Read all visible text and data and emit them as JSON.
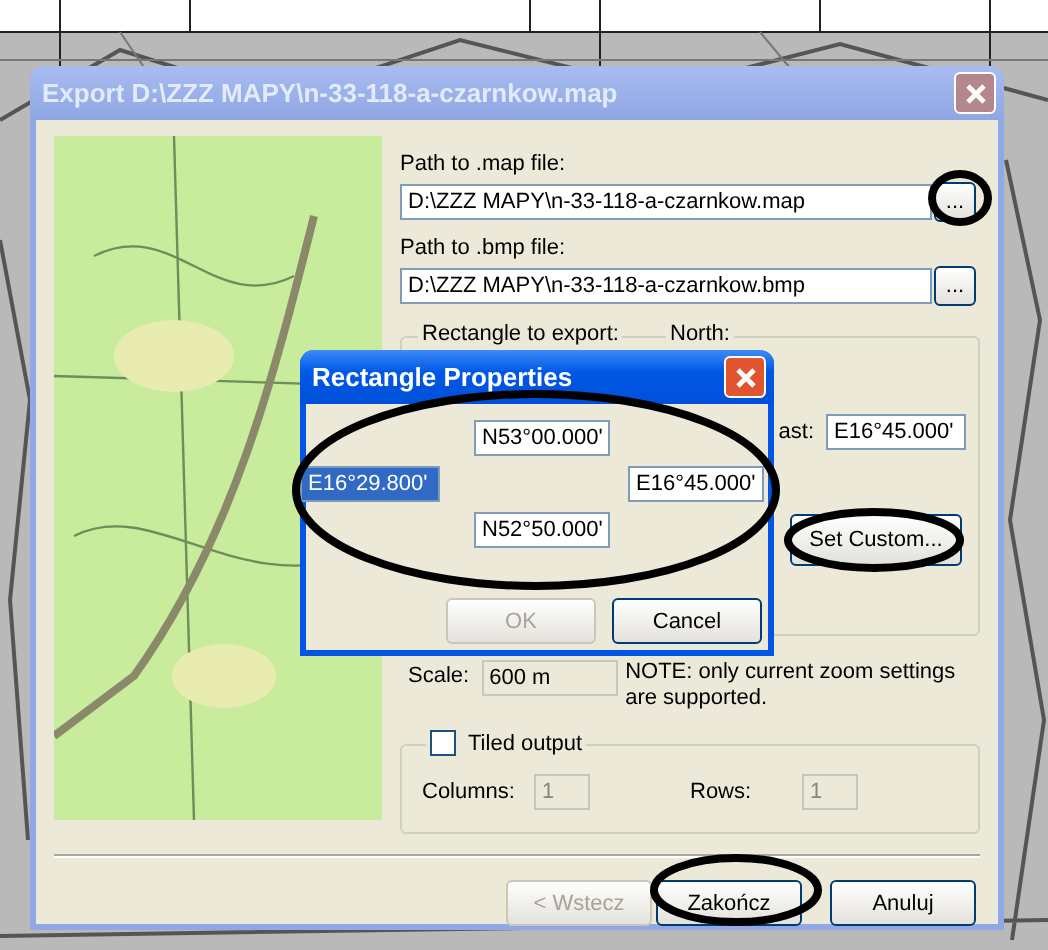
{
  "export_dialog": {
    "title": "Export D:\\ZZZ MAPY\\n-33-118-a-czarnkow.map",
    "map_file": {
      "label": "Path to .map file:",
      "value": "D:\\ZZZ MAPY\\n-33-118-a-czarnkow.map",
      "browse_button": "..."
    },
    "bmp_file": {
      "label": "Path to .bmp file:",
      "value": "D:\\ZZZ MAPY\\n-33-118-a-czarnkow.bmp",
      "browse_button": "..."
    },
    "rectangle_group": {
      "title": "Rectangle to export:",
      "north_label": "North:",
      "east_label": "ast:",
      "east_value": "E16°45.000'",
      "set_custom_button": "Set Custom..."
    },
    "scale": {
      "label": "Scale:",
      "value": "600 m"
    },
    "note": "NOTE: only current zoom settings are supported.",
    "tiled": {
      "label": "Tiled output",
      "checked": false,
      "disabled": true,
      "columns_label": "Columns:",
      "columns_value": "1",
      "rows_label": "Rows:",
      "rows_value": "1"
    },
    "buttons": [
      {
        "label": "< Wstecz",
        "disabled": true
      },
      {
        "label": "Zakończ",
        "disabled": false
      },
      {
        "label": "Anuluj",
        "disabled": false
      }
    ]
  },
  "rectangle_dialog": {
    "title": "Rectangle Properties",
    "north": "N53°00.000'",
    "west": {
      "value": "E16°29.800'",
      "selected": true
    },
    "east": "E16°45.000'",
    "south": "N52°50.000'",
    "buttons": [
      {
        "label": "OK",
        "disabled": true
      },
      {
        "label": "Cancel",
        "disabled": false
      }
    ]
  }
}
